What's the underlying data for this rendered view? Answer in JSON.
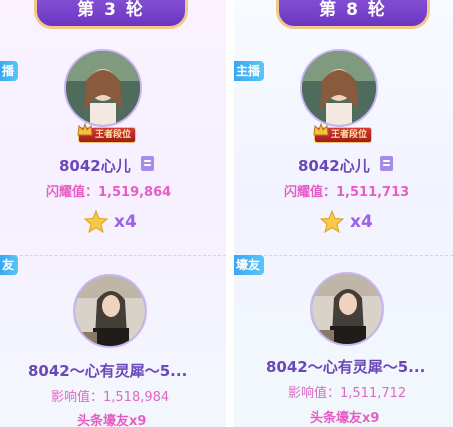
{
  "left": {
    "round_label": "第 3 轮",
    "top_tag": "播",
    "top_card": {
      "name": "8042心儿",
      "badge": "王者段位",
      "stat": "闪耀值：1,519,864",
      "stars": "x4"
    },
    "bottom_tag": "友",
    "bottom_card": {
      "name": "8042～心有灵犀～5...",
      "stat": "影响值：1,518,984",
      "caption": "头条壕友x9"
    }
  },
  "right": {
    "round_label": "第 8 轮",
    "top_tag": "主播",
    "top_card": {
      "name": "8042心儿",
      "badge": "王者段位",
      "stat": "闪耀值：1,511,713",
      "stars": "x4"
    },
    "bottom_tag": "壕友",
    "bottom_card": {
      "name": "8042～心有灵犀～5...",
      "stat": "影响值：1,511,712",
      "caption": "头条壕友x9"
    }
  },
  "icons": {
    "star": "star-icon",
    "crown": "crown-icon",
    "profile": "profile-card-icon"
  },
  "colors": {
    "banner": "#7a45cc",
    "name": "#6b47b8",
    "stat_pink": "#e65ec3",
    "tag_blue": "#3aa8f0"
  }
}
